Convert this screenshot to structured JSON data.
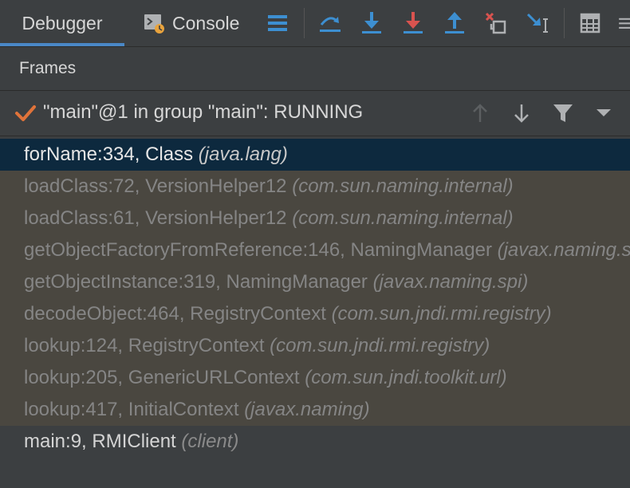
{
  "tabs": {
    "debugger_label": "Debugger",
    "console_label": "Console"
  },
  "toolbar": {
    "icons": [
      "layout-menu-icon",
      "show-execution-point-icon",
      "step-over-icon",
      "step-into-icon",
      "force-step-into-icon",
      "step-out-icon",
      "drop-frame-icon",
      "run-to-cursor-icon",
      "evaluate-expression-icon",
      "more-icon"
    ]
  },
  "frames_panel": {
    "title": "Frames"
  },
  "thread": {
    "label": "\"main\"@1 in group \"main\": RUNNING"
  },
  "frames": [
    {
      "method": "forName:334, Class",
      "package": "(java.lang)",
      "kind": "selected"
    },
    {
      "method": "loadClass:72, VersionHelper12",
      "package": "(com.sun.naming.internal)",
      "kind": "library"
    },
    {
      "method": "loadClass:61, VersionHelper12",
      "package": "(com.sun.naming.internal)",
      "kind": "library"
    },
    {
      "method": "getObjectFactoryFromReference:146, NamingManager",
      "package": "(javax.naming.spi)",
      "kind": "library"
    },
    {
      "method": "getObjectInstance:319, NamingManager",
      "package": "(javax.naming.spi)",
      "kind": "library"
    },
    {
      "method": "decodeObject:464, RegistryContext",
      "package": "(com.sun.jndi.rmi.registry)",
      "kind": "library"
    },
    {
      "method": "lookup:124, RegistryContext",
      "package": "(com.sun.jndi.rmi.registry)",
      "kind": "library"
    },
    {
      "method": "lookup:205, GenericURLContext",
      "package": "(com.sun.jndi.toolkit.url)",
      "kind": "library"
    },
    {
      "method": "lookup:417, InitialContext",
      "package": "(javax.naming)",
      "kind": "library"
    },
    {
      "method": "main:9, RMIClient",
      "package": "(client)",
      "kind": "normal"
    }
  ],
  "colors": {
    "accent": "#4a88c7",
    "selected_bg": "#0d293e",
    "library_bg": "#4a4740",
    "panel_bg": "#3c3f41",
    "check": "#e0733a"
  }
}
